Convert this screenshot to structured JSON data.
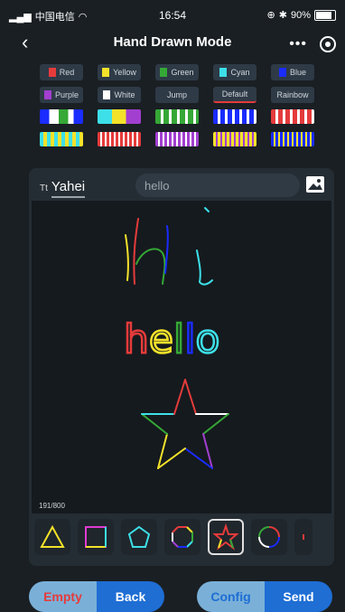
{
  "status": {
    "carrier": "中国电信",
    "time": "16:54",
    "battery": "90%"
  },
  "nav": {
    "title": "Hand Drawn Mode",
    "more": "•••"
  },
  "colors": [
    {
      "label": "Red",
      "color": "#e53b3b"
    },
    {
      "label": "Yellow",
      "color": "#f4e22a"
    },
    {
      "label": "Green",
      "color": "#35a836"
    },
    {
      "label": "Cyan",
      "color": "#3de0e8"
    },
    {
      "label": "Blue",
      "color": "#1a2cff"
    },
    {
      "label": "Purple",
      "color": "#a23fd0"
    },
    {
      "label": "White",
      "color": "#ffffff"
    },
    {
      "label": "Jump",
      "color": ""
    },
    {
      "label": "Default",
      "color": ""
    },
    {
      "label": "Rainbow",
      "color": ""
    }
  ],
  "font": {
    "icon": "Tt",
    "name": "Yahei"
  },
  "text_input": {
    "value": "hello"
  },
  "counter": "191/800",
  "canvas_text": "hello",
  "buttons": {
    "empty": "Empty",
    "back": "Back",
    "config": "Config",
    "send": "Send"
  }
}
